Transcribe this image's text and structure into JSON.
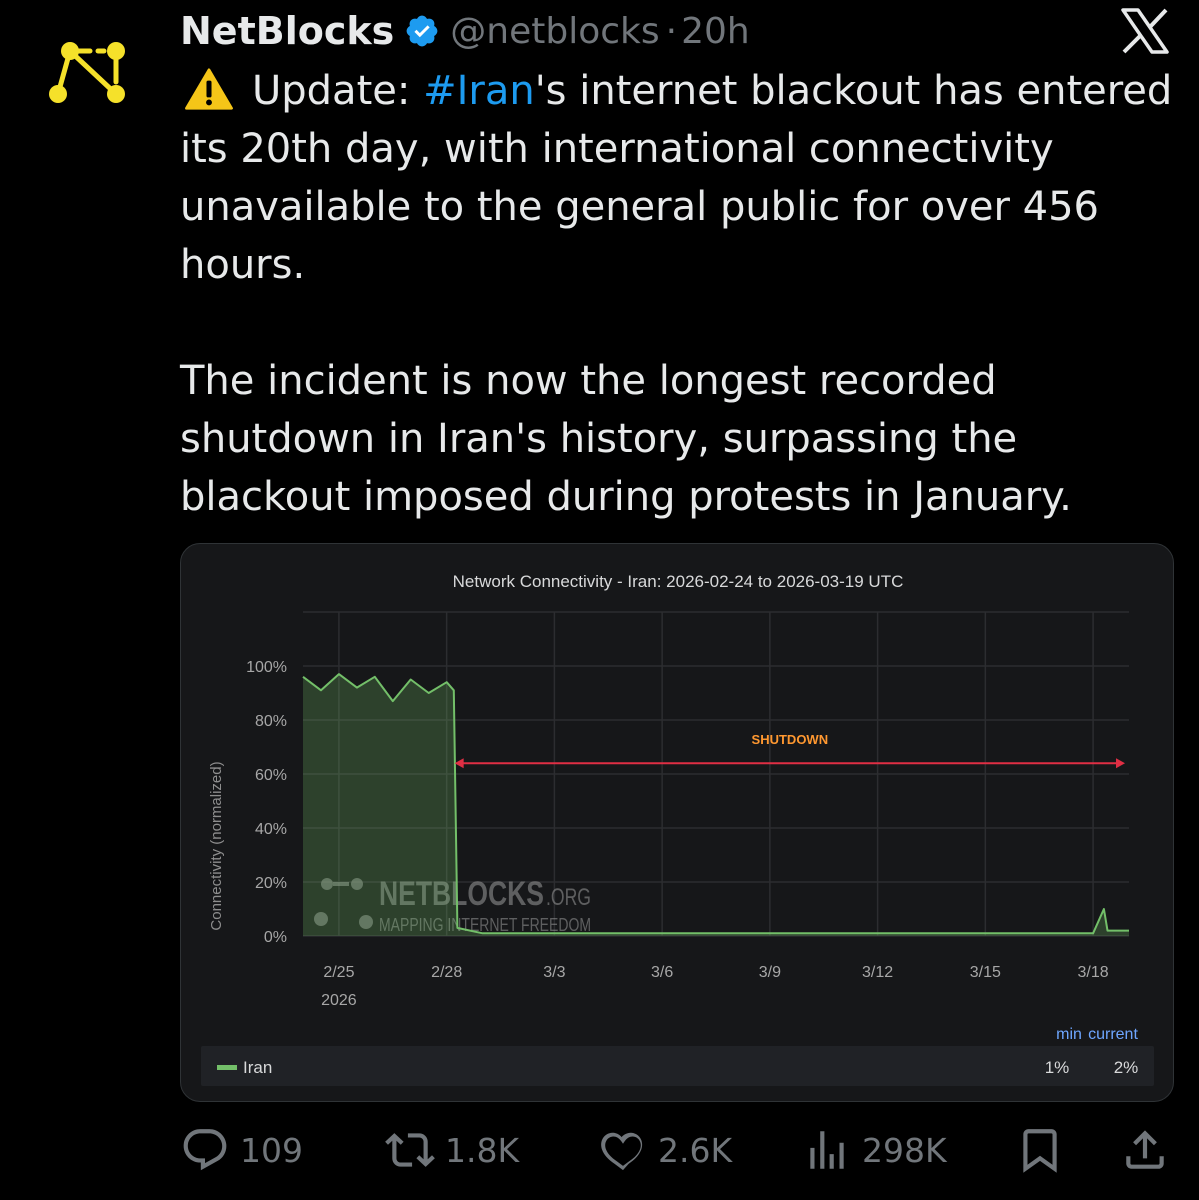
{
  "author": {
    "name": "NetBlocks",
    "handle": "@netblocks",
    "separator": "·",
    "time": "20h"
  },
  "tweet": {
    "line1_prefix": "Update: ",
    "hashtag": "#Iran",
    "line1_suffix": "'s internet blackout has entered",
    "line2": "its 20th day, with international connectivity",
    "line3": "unavailable to the general public for over 456",
    "line4": "hours.",
    "line5": "The incident is now the longest recorded",
    "line6": "shutdown in Iran's history, surpassing the",
    "line7": "blackout imposed during protests in January."
  },
  "colors": {
    "background": "#000000",
    "text": "#e7e9ea",
    "muted": "#71767b",
    "accent": "#1d9bf0",
    "series": "#73bf69",
    "annotation": "#e02f44",
    "annotation_label": "#ff9830",
    "logo": "#f5e12a"
  },
  "chart_data": {
    "type": "line",
    "title": "Network Connectivity - Iran: 2026-02-24 to 2026-03-19 UTC",
    "ylabel": "Connectivity (normalized)",
    "xlabel": "",
    "ylim": [
      0,
      100
    ],
    "xlim": [
      "2026-02-24",
      "2026-03-19"
    ],
    "yticks": [
      "100%",
      "80%",
      "60%",
      "40%",
      "20%",
      "0%"
    ],
    "xticks": [
      "2/25",
      "2/28",
      "3/3",
      "3/6",
      "3/9",
      "3/12",
      "3/15",
      "3/18"
    ],
    "xtick_year": "2026",
    "grid": true,
    "watermark": {
      "brand": "NETBLOCKS",
      "suffix": ".ORG",
      "tagline": "MAPPING INTERNET FREEDOM"
    },
    "annotation": {
      "label": "SHUTDOWN",
      "from": "2026-02-28",
      "to": "2026-03-19",
      "y": 64
    },
    "series": [
      {
        "name": "Iran",
        "points": [
          [
            "2026-02-24",
            96
          ],
          [
            "2026-02-24.5",
            91
          ],
          [
            "2026-02-25",
            97
          ],
          [
            "2026-02-25.5",
            92
          ],
          [
            "2026-02-26",
            96
          ],
          [
            "2026-02-26.5",
            87
          ],
          [
            "2026-02-27",
            95
          ],
          [
            "2026-02-27.5",
            90
          ],
          [
            "2026-02-28",
            94
          ],
          [
            "2026-02-28.2",
            91
          ],
          [
            "2026-02-28.3",
            3
          ],
          [
            "2026-03-01",
            1
          ],
          [
            "2026-03-05",
            1
          ],
          [
            "2026-03-10",
            1
          ],
          [
            "2026-03-15",
            1
          ],
          [
            "2026-03-18",
            1
          ],
          [
            "2026-03-18.3",
            10
          ],
          [
            "2026-03-18.4",
            2
          ],
          [
            "2026-03-19",
            2
          ]
        ]
      }
    ],
    "legend": {
      "name": "Iran",
      "min_label": "min",
      "current_label": "current",
      "min": "1%",
      "current": "2%"
    }
  },
  "metrics": {
    "replies": "109",
    "reposts": "1.8K",
    "likes": "2.6K",
    "views": "298K"
  }
}
